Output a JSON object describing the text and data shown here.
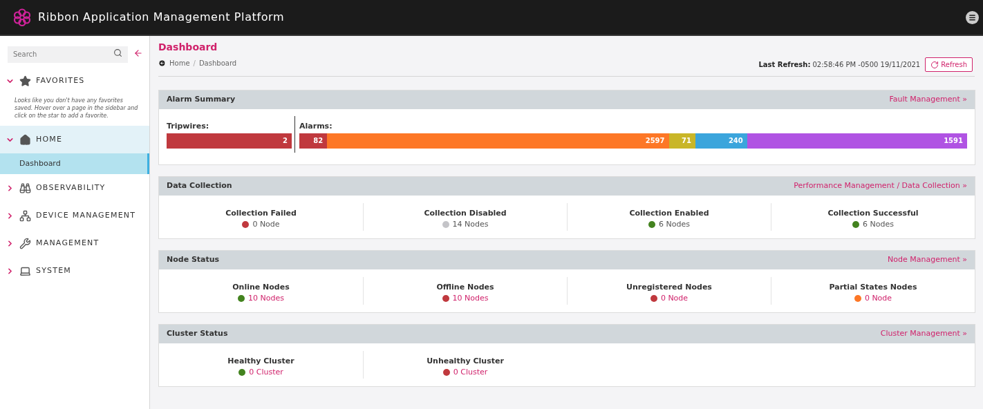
{
  "app": {
    "title": "Ribbon Application Management Platform"
  },
  "sidebar": {
    "search": {
      "placeholder": "Search"
    },
    "groups": [
      {
        "label": "FAVORITES",
        "kind": "star",
        "expanded": true,
        "note": "Looks like you don't have any favorites saved. Hover over a page in the sidebar and click on the star to add a favorite."
      },
      {
        "label": "HOME",
        "kind": "home",
        "expanded": true,
        "children": [
          {
            "label": "Dashboard",
            "selected": true
          }
        ]
      },
      {
        "label": "OBSERVABILITY",
        "kind": "binoculars",
        "expanded": false
      },
      {
        "label": "DEVICE MANAGEMENT",
        "kind": "network",
        "expanded": false
      },
      {
        "label": "MANAGEMENT",
        "kind": "tools",
        "expanded": false
      },
      {
        "label": "SYSTEM",
        "kind": "laptop",
        "expanded": false
      }
    ]
  },
  "page": {
    "title": "Dashboard",
    "breadcrumb": [
      "Home",
      "Dashboard"
    ],
    "breadcrumb_separator": "/",
    "last_refresh_label": "Last Refresh:",
    "last_refresh": "02:58:46 PM -0500 19/11/2021",
    "refresh_button": "Refresh"
  },
  "alarm_summary": {
    "title": "Alarm Summary",
    "link": "Fault Management »",
    "tripwires": {
      "label": "Tripwires:",
      "segments": [
        {
          "value": "2",
          "color": "#c0393e"
        }
      ]
    },
    "alarms": {
      "label": "Alarms:",
      "segments": [
        {
          "value": "82",
          "color": "#c0393e"
        },
        {
          "value": "2597",
          "color": "#fd7726"
        },
        {
          "value": "71",
          "color": "#c9b628"
        },
        {
          "value": "240",
          "color": "#3ba5dc"
        },
        {
          "value": "1591",
          "color": "#b053e3"
        }
      ]
    }
  },
  "panels": [
    {
      "title": "Data Collection",
      "link": "Performance Management / Data Collection »",
      "stats": [
        {
          "label": "Collection Failed",
          "count": "0 Node",
          "color": "#c0393e",
          "linked": false
        },
        {
          "label": "Collection Disabled",
          "count": "14 Nodes",
          "color": "#c4c4c8",
          "linked": false
        },
        {
          "label": "Collection Enabled",
          "count": "6 Nodes",
          "color": "#43831f",
          "linked": false
        },
        {
          "label": "Collection Successful",
          "count": "6 Nodes",
          "color": "#43831f",
          "linked": false
        }
      ]
    },
    {
      "title": "Node Status",
      "link": "Node Management »",
      "stats": [
        {
          "label": "Online Nodes",
          "count": "10 Nodes",
          "color": "#43831f",
          "linked": true
        },
        {
          "label": "Offline Nodes",
          "count": "10 Nodes",
          "color": "#c0393e",
          "linked": true
        },
        {
          "label": "Unregistered Nodes",
          "count": "0 Node",
          "color": "#c0393e",
          "linked": true
        },
        {
          "label": "Partial States Nodes",
          "count": "0 Node",
          "color": "#fd7726",
          "linked": true
        }
      ]
    },
    {
      "title": "Cluster Status",
      "link": "Cluster Management »",
      "stats": [
        {
          "label": "Healthy Cluster",
          "count": "0 Cluster",
          "color": "#43831f",
          "linked": true
        },
        {
          "label": "Unhealthy Cluster",
          "count": "0 Cluster",
          "color": "#c0393e",
          "linked": true
        }
      ]
    }
  ]
}
